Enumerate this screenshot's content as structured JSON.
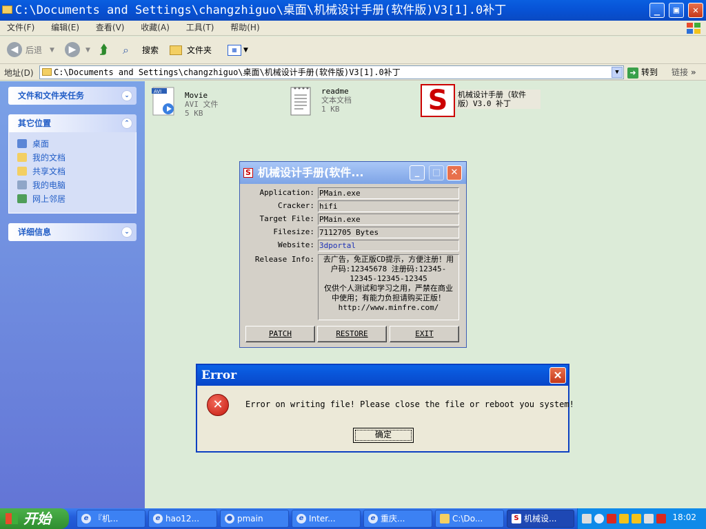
{
  "window": {
    "title": "C:\\Documents and Settings\\changzhiguo\\桌面\\机械设计手册(软件版)V3[1].0补丁"
  },
  "menu": [
    "文件(F)",
    "编辑(E)",
    "查看(V)",
    "收藏(A)",
    "工具(T)",
    "帮助(H)"
  ],
  "toolbar": {
    "back": "后退",
    "search": "搜索",
    "folders": "文件夹"
  },
  "address": {
    "label": "地址(D)",
    "value": "C:\\Documents and Settings\\changzhiguo\\桌面\\机械设计手册(软件版)V3[1].0补丁",
    "go": "转到",
    "links": "链接"
  },
  "sidebar": {
    "tasks_title": "文件和文件夹任务",
    "places_title": "其它位置",
    "places": [
      "桌面",
      "我的文档",
      "共享文档",
      "我的电脑",
      "网上邻居"
    ],
    "details_title": "详细信息"
  },
  "files": [
    {
      "name": "Movie",
      "type": "AVI 文件",
      "size": "5 KB"
    },
    {
      "name": "readme",
      "type": "文本文档",
      "size": "1 KB"
    },
    {
      "name_line1": "机械设计手册（软件",
      "name_line2": "版）V3.0 补丁"
    }
  ],
  "crack": {
    "title": "机械设计手册(软件...",
    "fields": [
      {
        "label": "Application:",
        "value": "PMain.exe"
      },
      {
        "label": "Cracker:",
        "value": "hifi"
      },
      {
        "label": "Target File:",
        "value": "PMain.exe"
      },
      {
        "label": "Filesize:",
        "value": "7112705 Bytes"
      },
      {
        "label": "Website:",
        "value": "3dportal"
      }
    ],
    "release_label": "Release Info:",
    "release_info": "去广告，免正版CD提示，方便注册！用户码:12345678 注册码:12345-12345-12345-12345\n仅供个人测试和学习之用，严禁在商业中使用；有能力负担请购买正版！\nhttp://www.minfre.com/",
    "buttons": [
      "PATCH",
      "RESTORE",
      "EXIT"
    ]
  },
  "error": {
    "title": "Error",
    "message": "Error on writing file! Please close the file or reboot you system!",
    "ok": "确定"
  },
  "taskbar": {
    "start": "开始",
    "tasks": [
      "『机...",
      "hao12...",
      "pmain",
      "Inter...",
      "重庆...",
      "C:\\Do...",
      "机械设..."
    ],
    "clock": "18:02"
  }
}
